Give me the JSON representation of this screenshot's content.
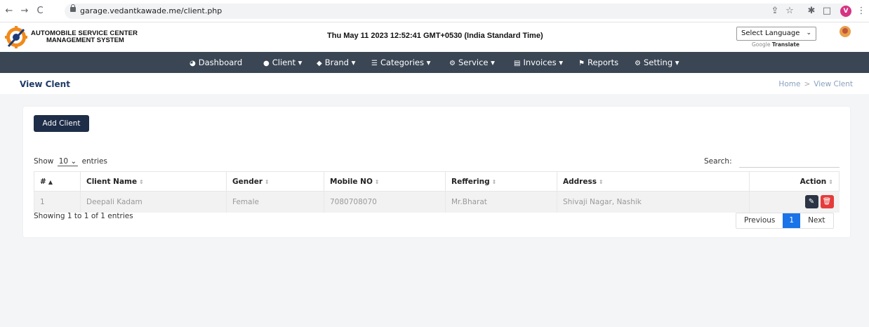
{
  "browser": {
    "back_icon": "←",
    "forward_icon": "→",
    "reload_icon": "C",
    "url": "garage.vedantkawade.me/client.php",
    "profile_initial": "V"
  },
  "header": {
    "brand_line1": "AUTOMOBILE SERVICE CENTER",
    "brand_line2": "MANAGEMENT SYSTEM",
    "datetime": "Thu May 11 2023 12:52:41 GMT+0530 (India Standard Time)",
    "language_select": "Select Language",
    "google_label": "Google",
    "translate_label": "Translate"
  },
  "nav": {
    "items": [
      {
        "label": "Dashboard"
      },
      {
        "label": "Client ▾"
      },
      {
        "label": "Brand ▾"
      },
      {
        "label": "Categories ▾"
      },
      {
        "label": "Service ▾"
      },
      {
        "label": "Invoices ▾"
      },
      {
        "label": "Reports"
      },
      {
        "label": "Setting ▾"
      }
    ]
  },
  "page": {
    "title": "View Clent",
    "breadcrumb": [
      "Home",
      "View Clent"
    ]
  },
  "card": {
    "add_button": "Add Client",
    "show_label": "Show",
    "show_value": "10",
    "entries_label": "entries",
    "search_label": "Search:",
    "search_value": "",
    "columns": [
      "#",
      "Client Name",
      "Gender",
      "Mobile NO",
      "Reffering",
      "Address",
      "Action"
    ],
    "rows": [
      {
        "num": "1",
        "name": "Deepali Kadam",
        "gender": "Female",
        "mobile": "7080708070",
        "reffering": "Mr.Bharat",
        "address": "Shivaji Nagar, Nashik"
      }
    ],
    "showing": "Showing 1 to 1 of 1 entries",
    "pager": {
      "previous": "Previous",
      "current": "1",
      "next": "Next"
    }
  },
  "colors": {
    "nav_bg": "#3a4654",
    "title": "#1f3a68",
    "add_button": "#1e2d48",
    "edit_button": "#2b3545",
    "delete_button": "#e63b3b",
    "pager_active": "#1a73e8"
  }
}
